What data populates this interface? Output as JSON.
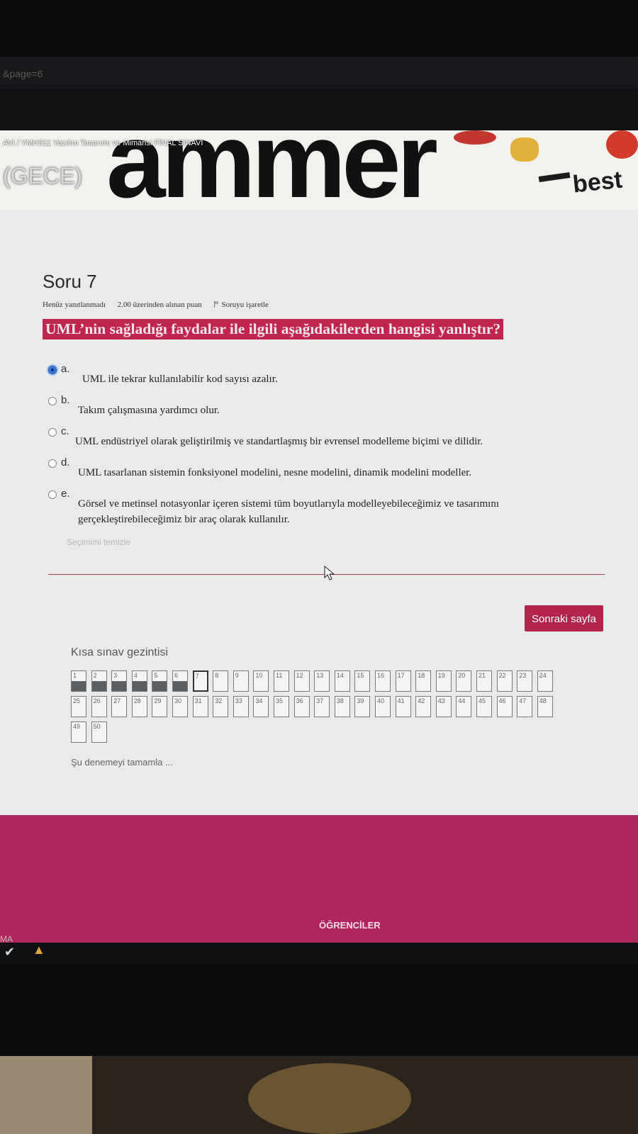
{
  "browser": {
    "url_fragment": "&page=6"
  },
  "header": {
    "breadcrumb": "AVI  /  YMH311 Yazılım Tasarımı ve Mimarisi FİNAL SINAVI",
    "course_suffix": "(GECE)",
    "banner_word": "ammer",
    "banner_word_2": "best"
  },
  "question": {
    "title": "Soru 7",
    "status": "Henüz yanıtlanmadı",
    "points": "2.00 üzerinden alınan puan",
    "flag_label": "Soruyu işaretle",
    "text": "UML’nin sağladığı faydalar ile ilgili aşağıdakilerden hangisi yanlıştır?",
    "options": [
      {
        "letter": "a.",
        "text": "UML ile tekrar kullanılabilir kod sayısı azalır.",
        "selected": true
      },
      {
        "letter": "b.",
        "text": "Takım çalışmasına yardımcı olur.",
        "selected": false
      },
      {
        "letter": "c.",
        "text": "UML endüstriyel olarak geliştirilmiş ve standartlaşmış bir evrensel modelleme biçimi ve dilidir.",
        "selected": false
      },
      {
        "letter": "d.",
        "text": "UML tasarlanan sistemin fonksiyonel modelini, nesne modelini, dinamik modelini modeller.",
        "selected": false
      },
      {
        "letter": "e.",
        "text": "Görsel ve metinsel notasyonlar içeren sistemi tüm boyutlarıyla modelleyebileceğimiz ve tasarımını gerçekleştirebileceğimiz bir araç olarak kullanılır.",
        "selected": false
      }
    ],
    "clear_label": "Seçimimi temizle"
  },
  "next_button": "Sonraki sayfa",
  "quiz_nav": {
    "title": "Kısa sınav gezintisi",
    "answered": [
      1,
      2,
      3,
      4,
      5,
      6
    ],
    "current": 7,
    "items": [
      "1",
      "2",
      "3",
      "4",
      "5",
      "6",
      "7",
      "8",
      "9",
      "10",
      "11",
      "12",
      "13",
      "14",
      "15",
      "16",
      "17",
      "18",
      "19",
      "20",
      "21",
      "22",
      "23",
      "24",
      "25",
      "26",
      "27",
      "28",
      "29",
      "30",
      "31",
      "32",
      "33",
      "34",
      "35",
      "36",
      "37",
      "38",
      "39",
      "40",
      "41",
      "42",
      "43",
      "44",
      "45",
      "46",
      "47",
      "48",
      "49",
      "50"
    ],
    "finish_label": "Şu denemeyi tamamla ..."
  },
  "footer": {
    "text": "ÖĞRENCİLER"
  },
  "taskbar": {
    "left_text": "MA"
  },
  "colors": {
    "accent": "#b2245e",
    "question_highlight": "#c1244f",
    "button": "#b3254d"
  }
}
